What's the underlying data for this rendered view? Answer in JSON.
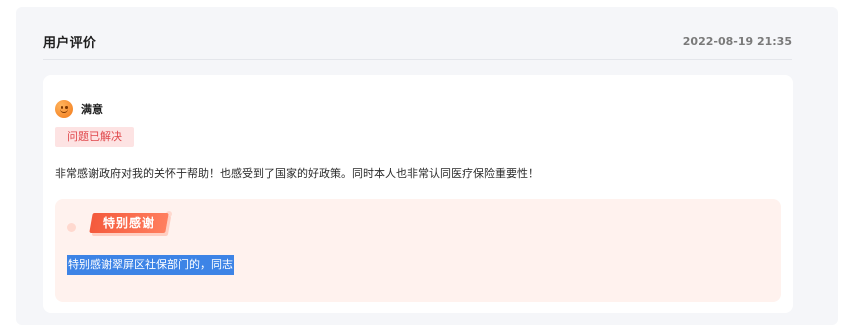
{
  "header": {
    "title": "用户评价",
    "timestamp": "2022-08-19 21:35"
  },
  "review": {
    "rating_icon": "smile-icon",
    "rating_label": "满意",
    "status_badge": "问题已解决",
    "comment": "非常感谢政府对我的关怀于帮助！也感受到了国家的好政策。同时本人也非常认同医疗保险重要性！",
    "thanks": {
      "ribbon_label": "特别感谢",
      "text": "特别感谢翠屏区社保部门的，同志"
    }
  },
  "colors": {
    "badge_bg": "#fde3e3",
    "badge_text": "#e0474b",
    "thanks_bg": "#fff2ee",
    "ribbon": "#f45a3c",
    "selection": "#3d84e6"
  }
}
